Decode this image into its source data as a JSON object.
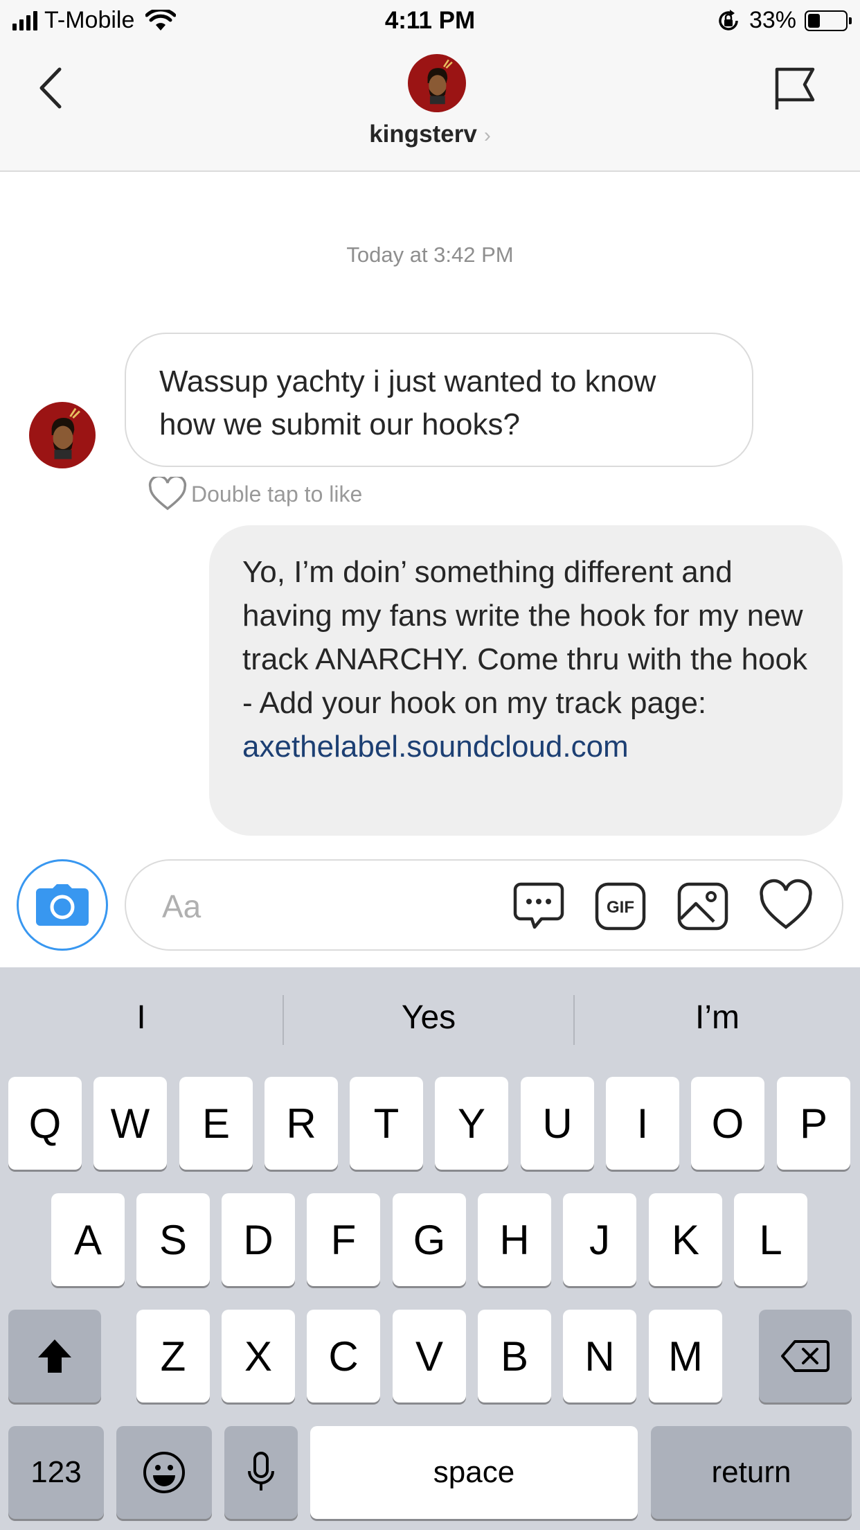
{
  "status_bar": {
    "carrier": "T-Mobile",
    "time": "4:11 PM",
    "battery_percent": "33%",
    "battery_level": 0.33
  },
  "header": {
    "username": "kingsterv",
    "chevron": "›",
    "icons": {
      "back": "chevron-left-icon",
      "flag": "flag-icon"
    }
  },
  "thread": {
    "timestamp": "Today at 3:42 PM",
    "incoming_message": "Wassup yachty i just wanted to know how we submit our hooks?",
    "like_hint": "Double tap to like",
    "outgoing_message_text": "Yo, I’m doin’ something different and having my fans write the hook for my new track ANARCHY. Come thru with the hook - Add your hook on my track page:",
    "outgoing_message_link": "axethelabel.soundcloud.com"
  },
  "composer": {
    "placeholder": "Aa",
    "value": "",
    "icons": [
      "camera-icon",
      "chat-bubble-icon",
      "gif-icon",
      "image-icon",
      "heart-icon"
    ],
    "accent_color": "#3897f0"
  },
  "keyboard": {
    "suggestions": [
      "I",
      "Yes",
      "I’m"
    ],
    "row1": [
      "Q",
      "W",
      "E",
      "R",
      "T",
      "Y",
      "U",
      "I",
      "O",
      "P"
    ],
    "row2": [
      "A",
      "S",
      "D",
      "F",
      "G",
      "H",
      "J",
      "K",
      "L"
    ],
    "row3": [
      "Z",
      "X",
      "C",
      "V",
      "B",
      "N",
      "M"
    ],
    "numbers_key": "123",
    "space_key": "space",
    "return_key": "return"
  }
}
